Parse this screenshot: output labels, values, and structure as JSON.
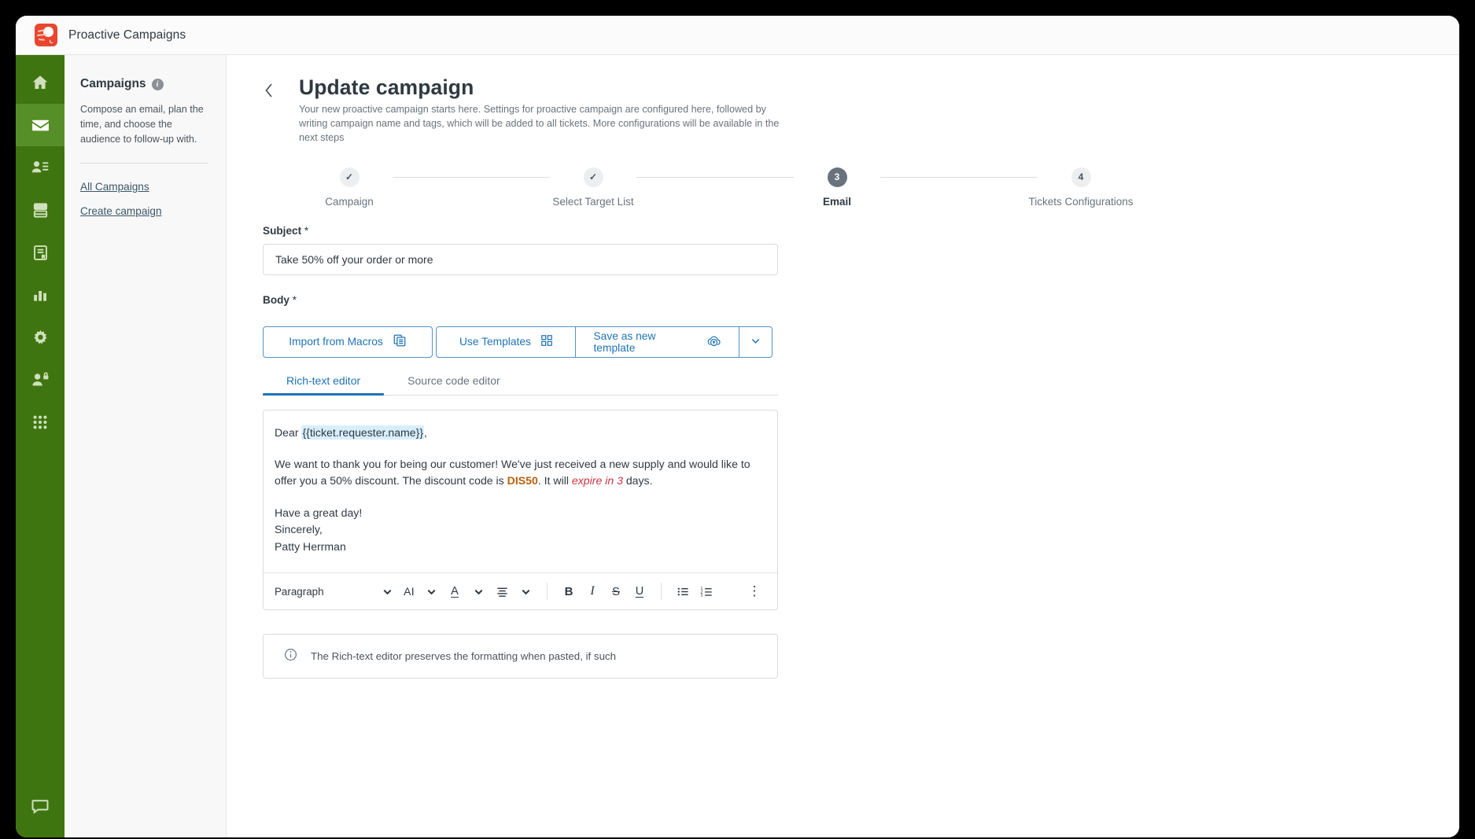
{
  "window": {
    "app_title": "Proactive Campaigns",
    "logo_name": "proactive-campaigns-logo"
  },
  "rail": {
    "items": [
      {
        "name": "home-icon",
        "label": "Home",
        "active": false
      },
      {
        "name": "mail-icon",
        "label": "Campaigns",
        "active": true
      },
      {
        "name": "user-list-icon",
        "label": "Customer Lists",
        "active": false
      },
      {
        "name": "database-icon",
        "label": "Data",
        "active": false
      },
      {
        "name": "book-icon",
        "label": "Knowledge",
        "active": false
      },
      {
        "name": "bar-chart-icon",
        "label": "Reports",
        "active": false
      },
      {
        "name": "gear-icon",
        "label": "Settings",
        "active": false
      },
      {
        "name": "user-lock-icon",
        "label": "Admin",
        "active": false
      },
      {
        "name": "grid-apps-icon",
        "label": "Apps",
        "active": false
      }
    ],
    "bottom": {
      "name": "chat-icon",
      "label": "Support Chat"
    }
  },
  "sidebar": {
    "heading": "Campaigns",
    "info_badge": "i",
    "description": "Compose an email, plan the time, and choose the audience to follow-up with.",
    "links": [
      {
        "label": "All Campaigns"
      },
      {
        "label": "Create campaign"
      }
    ]
  },
  "main": {
    "back_label": "Back",
    "title": "Update campaign",
    "description": "Your new proactive campaign starts here. Settings for proactive campaign are configured here, followed by writing campaign name and tags, which will be added to all tickets. More configurations will be available in the next steps"
  },
  "stepper": {
    "steps": [
      {
        "marker": "✓",
        "label": "Campaign",
        "state": "complete"
      },
      {
        "marker": "✓",
        "label": "Select Target List",
        "state": "complete"
      },
      {
        "marker": "3",
        "label": "Email",
        "state": "current"
      },
      {
        "marker": "4",
        "label": "Tickets Configurations",
        "state": "upcoming"
      }
    ]
  },
  "form": {
    "subject": {
      "label": "Subject",
      "required_marker": "*",
      "value": "Take 50% off your order or more",
      "placeholder": "Take 50% off your order or more"
    },
    "body": {
      "label": "Body",
      "required_marker": "*"
    },
    "buttons": {
      "import_from_macros": "Import from Macros",
      "use_templates": "Use Templates",
      "save_as_new_template": "Save as new template",
      "more_caret": "⌄"
    }
  },
  "tabs": [
    {
      "label": "Rich-text editor",
      "active": true
    },
    {
      "label": "Source code editor",
      "active": false
    }
  ],
  "editor": {
    "greeting_prefix": "Dear ",
    "greeting_token": "{{ticket.requester.name}}",
    "greeting_suffix": ",",
    "paragraph_1_a": "We want to thank you for being our customer! We've just received a new supply and would like to offer you a 50% discount. The discount code is ",
    "paragraph_1_code": "DIS50",
    "paragraph_1_b": ". It will ",
    "paragraph_1_expire": "expire in 3",
    "paragraph_1_c": " days.",
    "signoff_1": "Have a great day!",
    "signoff_2": "Sincerely,",
    "signoff_3": "Patty Herrman",
    "toolbar": {
      "block_format": "Paragraph",
      "block_format_caret": "⌄",
      "ai_label": "AI",
      "ai_caret": "⌄",
      "font_color": "A",
      "font_color_caret": "⌄",
      "align_caret": "⌄",
      "bold": "B",
      "italic": "I",
      "strikethrough": "S",
      "underline": "U",
      "bullet_list": "bullet-list",
      "ordered_list": "ordered-list",
      "overflow": "⋮"
    }
  },
  "note": {
    "icon": "info-icon",
    "text": "The Rich-text editor preserves the formatting when pasted, if such"
  }
}
